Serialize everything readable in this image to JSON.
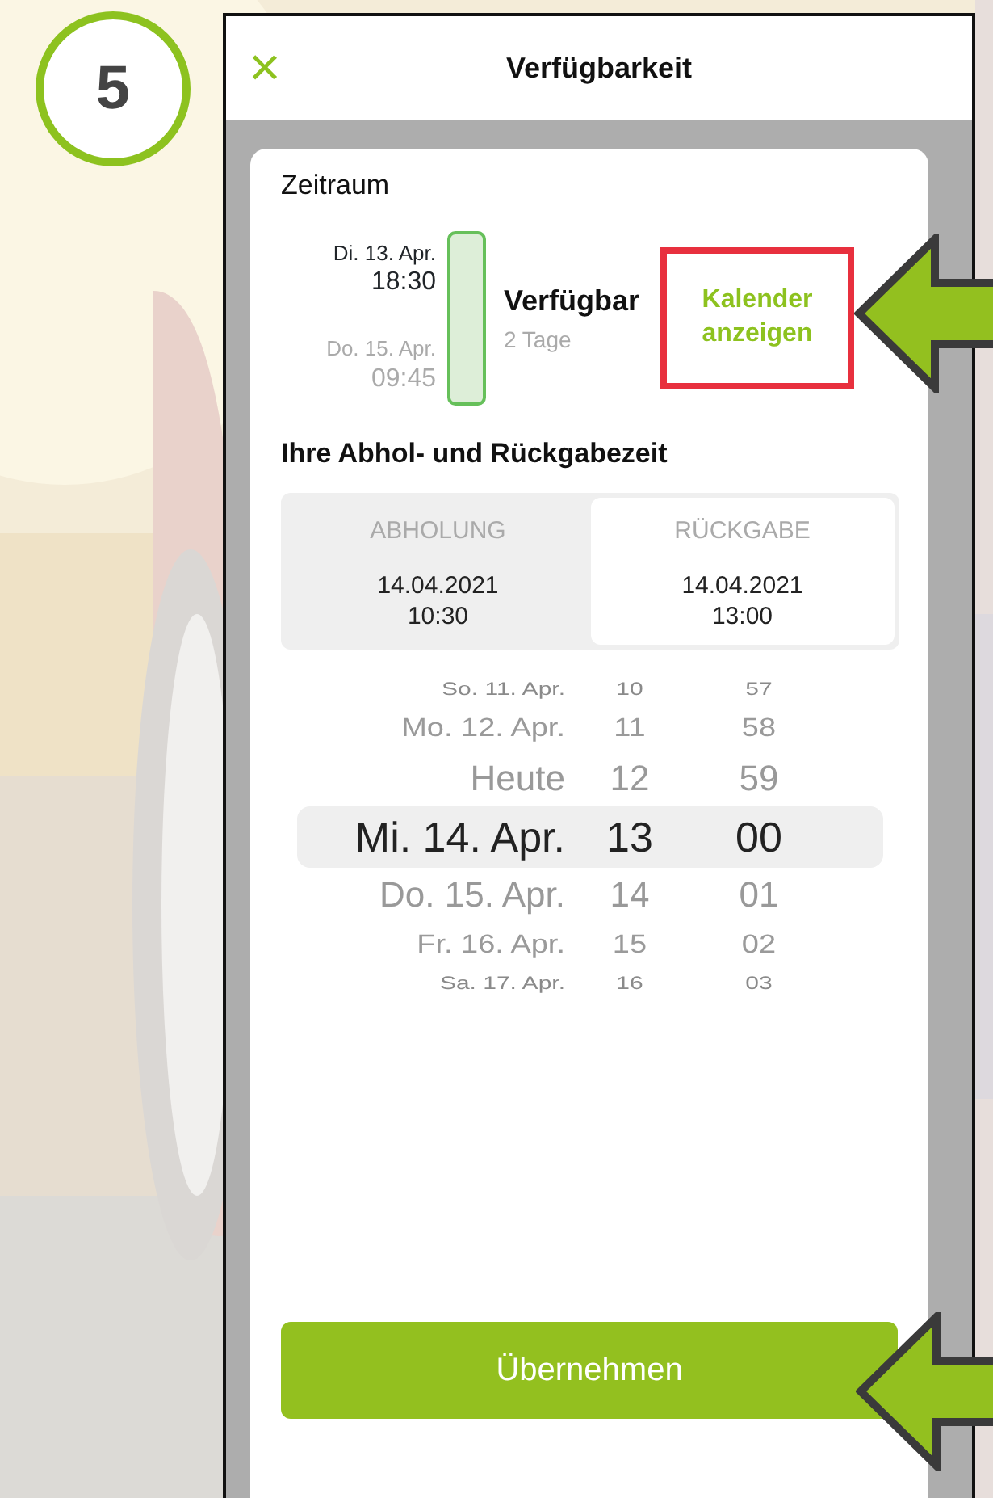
{
  "step": {
    "number": "5"
  },
  "header": {
    "close": "×",
    "title": "Verfügbarkeit"
  },
  "period": {
    "heading": "Zeitraum",
    "start_date": "Di. 13. Apr.",
    "start_time": "18:30",
    "end_date": "Do. 15. Apr.",
    "end_time": "09:45",
    "status": "Verfügbar",
    "duration": "2 Tage",
    "calendar_link": "Kalender anzeigen",
    "highlighted": true
  },
  "times": {
    "heading": "Ihre Abhol- und Rückgabezeit",
    "tabs": [
      {
        "label": "ABHOLUNG",
        "date": "14.04.2021",
        "time": "10:30",
        "selected": false
      },
      {
        "label": "RÜCKGABE",
        "date": "14.04.2021",
        "time": "13:00",
        "selected": true
      }
    ]
  },
  "picker": {
    "rows": [
      {
        "day": "So. 11. Apr.",
        "hour": "10",
        "minute": "57",
        "selected": false
      },
      {
        "day": "Mo. 12. Apr.",
        "hour": "11",
        "minute": "58",
        "selected": false
      },
      {
        "day": "Heute",
        "hour": "12",
        "minute": "59",
        "selected": false
      },
      {
        "day": "Mi. 14. Apr.",
        "hour": "13",
        "minute": "00",
        "selected": true
      },
      {
        "day": "Do. 15. Apr.",
        "hour": "14",
        "minute": "01",
        "selected": false
      },
      {
        "day": "Fr. 16. Apr.",
        "hour": "15",
        "minute": "02",
        "selected": false
      },
      {
        "day": "Sa. 17. Apr.",
        "hour": "16",
        "minute": "03",
        "selected": false
      }
    ]
  },
  "apply_button": "Übernehmen",
  "pointers": [
    {
      "kind": "arrow"
    },
    {
      "kind": "arrow"
    }
  ]
}
